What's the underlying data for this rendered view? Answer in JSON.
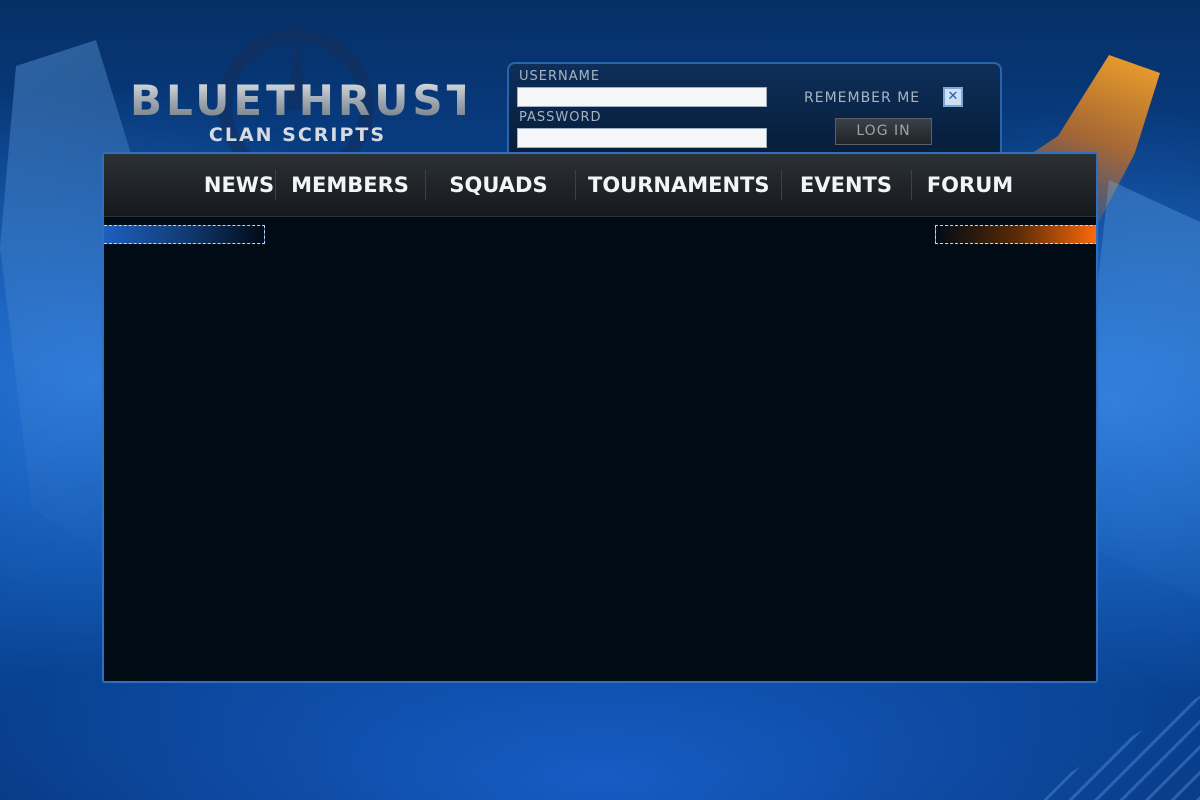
{
  "logo": {
    "title": "BLUETHRUST",
    "subtitle": "CLAN SCRIPTS"
  },
  "login": {
    "username_label": "USERNAME",
    "username_value": "",
    "password_label": "PASSWORD",
    "password_value": "",
    "remember_label": "REMEMBER ME",
    "remember_checked": true,
    "remember_mark": "✕",
    "login_button": "LOG IN"
  },
  "nav": {
    "items": [
      {
        "label": "NEWS"
      },
      {
        "label": "MEMBERS"
      },
      {
        "label": "SQUADS"
      },
      {
        "label": "TOURNAMENTS"
      },
      {
        "label": "EVENTS"
      },
      {
        "label": "FORUM"
      }
    ]
  },
  "colors": {
    "background_blue": "#0c4ea6",
    "frame_border": "#2f6fbd",
    "content_bg": "#000b16",
    "accent_orange": "#ff6a0c",
    "accent_blue": "#1e5fbf"
  },
  "icons": {
    "remember_checkbox": "checkbox-x-icon",
    "emblem": "emblem-icon"
  }
}
